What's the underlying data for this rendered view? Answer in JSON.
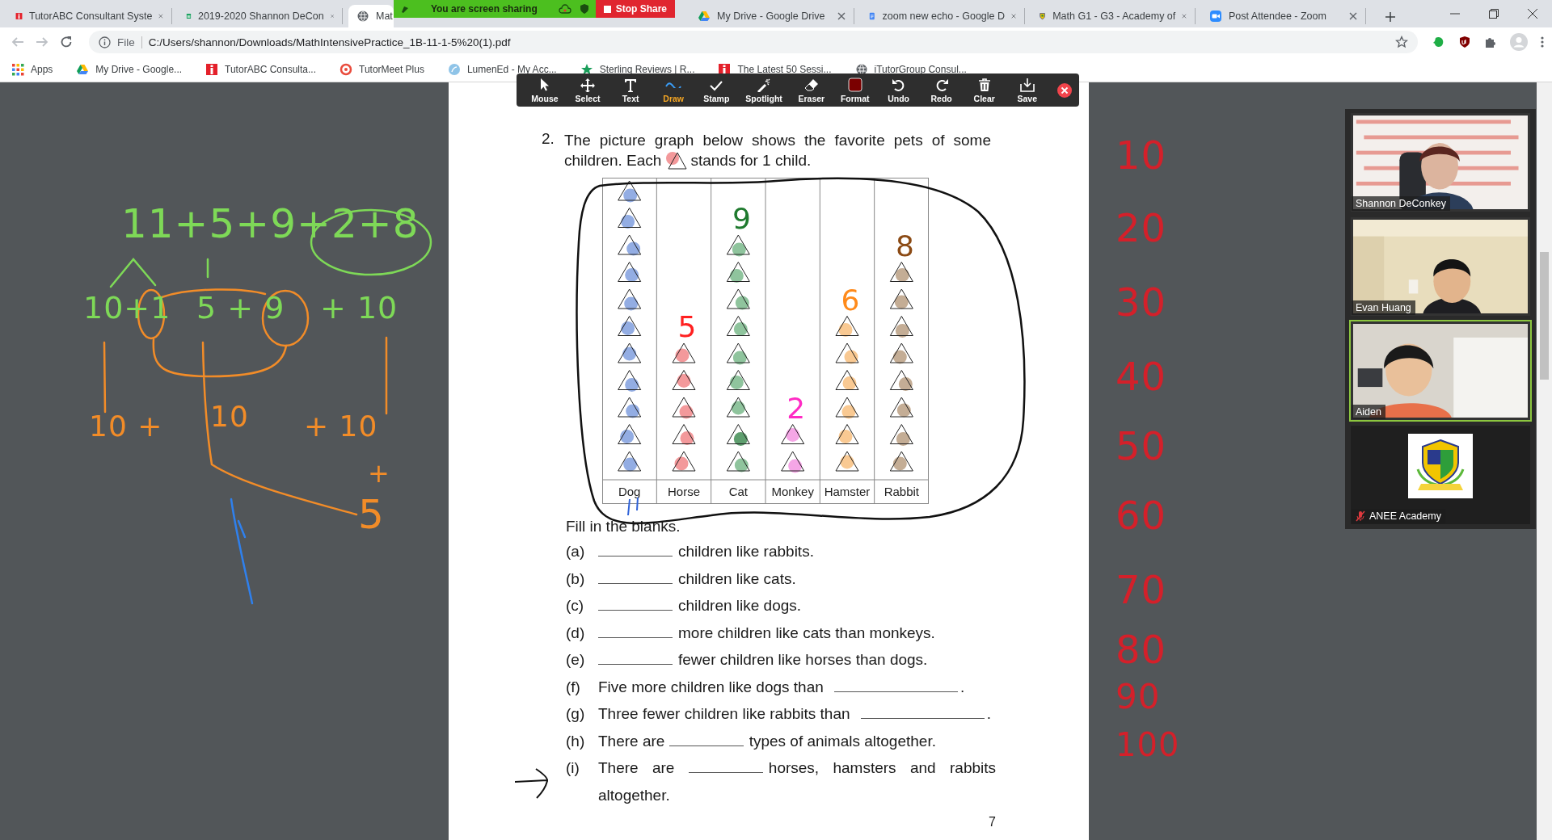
{
  "browser": {
    "tabs": [
      {
        "title": "TutorABC Consultant Syste",
        "kind": "square",
        "selected": false
      },
      {
        "title": "2019-2020 Shannon DeCon",
        "kind": "sheet",
        "selected": false
      },
      {
        "title": "Mat",
        "kind": "globe",
        "selected": true
      },
      {
        "title": "My Drive - Google Drive",
        "kind": "triangle",
        "selected": false
      },
      {
        "title": "zoom new echo - Google D",
        "kind": "doc",
        "selected": false
      },
      {
        "title": "Math G1 - G3 - Academy of",
        "kind": "shield",
        "selected": false
      },
      {
        "title": "Post Attendee - Zoom",
        "kind": "camera",
        "selected": false
      }
    ],
    "address": {
      "scheme": "File",
      "url": "C:/Users/shannon/Downloads/MathIntensivePractice_1B-11-1-5%20(1).pdf"
    },
    "bookmarks": [
      {
        "label": "Apps",
        "kind": "grid"
      },
      {
        "label": "My Drive - Google...",
        "kind": "triangle"
      },
      {
        "label": "TutorABC Consulta...",
        "kind": "square"
      },
      {
        "label": "TutorMeet Plus",
        "kind": "ring"
      },
      {
        "label": "LumenEd - My Acc...",
        "kind": "disc"
      },
      {
        "label": "Sterling Reviews | R...",
        "kind": "star"
      },
      {
        "label": "The Latest 50 Sessi...",
        "kind": "square"
      },
      {
        "label": "iTutorGroup Consul...",
        "kind": "globe"
      }
    ]
  },
  "screen_share_bar": {
    "status": "You are screen sharing",
    "stop_button": "Stop Share"
  },
  "annotation_toolbar": {
    "tools": [
      {
        "label": "Mouse",
        "selected": false
      },
      {
        "label": "Select",
        "selected": false
      },
      {
        "label": "Text",
        "selected": false
      },
      {
        "label": "Draw",
        "selected": true
      },
      {
        "label": "Stamp",
        "selected": false
      },
      {
        "label": "Spotlight",
        "selected": false
      },
      {
        "label": "Eraser",
        "selected": false
      },
      {
        "label": "Format",
        "selected": false
      },
      {
        "label": "Undo",
        "selected": false
      },
      {
        "label": "Redo",
        "selected": false
      },
      {
        "label": "Clear",
        "selected": false
      },
      {
        "label": "Save",
        "selected": false
      }
    ]
  },
  "document": {
    "question": {
      "number": "2.",
      "line": "The picture graph below shows the favorite pets of some",
      "legend_before": "children. Each",
      "legend_after": "stands for 1 child."
    },
    "graph": {
      "columns": [
        {
          "label": "Dog",
          "symbols": [
            {
              "color": "#93ade3"
            },
            {
              "color": "#93ade3"
            },
            {
              "color": "#93ade3"
            },
            {
              "color": "#93ade3"
            },
            {
              "color": "#93ade3"
            },
            {
              "color": "#93ade3"
            },
            {
              "color": "#93ade3"
            },
            {
              "color": "#93ade3"
            },
            {
              "color": "#93ade3"
            },
            {
              "color": "#93ade3"
            },
            {
              "color": "#93ade3"
            }
          ]
        },
        {
          "label": "Horse",
          "symbols": [
            {
              "color": "#f3999b"
            },
            {
              "color": "#f3999b"
            },
            {
              "color": "#f3999b"
            },
            {
              "color": "#f3999b"
            },
            {
              "color": "#f3999b"
            }
          ],
          "note": {
            "text": "5",
            "color": "#ff2020"
          }
        },
        {
          "label": "Cat",
          "symbols": [
            {
              "color": "#8fc49d"
            },
            {
              "color": "#5e9e6e"
            },
            {
              "color": "#8fc49d"
            },
            {
              "color": "#8fc49d"
            },
            {
              "color": "#8fc49d"
            },
            {
              "color": "#8fc49d"
            },
            {
              "color": "#8fc49d"
            },
            {
              "color": "#8fc49d"
            },
            {
              "color": "#8fc49d"
            }
          ],
          "note": {
            "text": "9",
            "color": "#1f7a2e"
          }
        },
        {
          "label": "Monkey",
          "symbols": [
            {
              "color": "#f5a6e6"
            },
            {
              "color": "#f5a6e6"
            }
          ],
          "note": {
            "text": "2",
            "color": "#ff2bc4"
          }
        },
        {
          "label": "Hamster",
          "symbols": [
            {
              "color": "#f9c992"
            },
            {
              "color": "#f9c992"
            },
            {
              "color": "#f9c992"
            },
            {
              "color": "#f9c992"
            },
            {
              "color": "#f9c992"
            },
            {
              "color": "#f9c992"
            }
          ],
          "note": {
            "text": "6",
            "color": "#ff8a1a"
          }
        },
        {
          "label": "Rabbit",
          "symbols": [
            {
              "color": "#c4ad95"
            },
            {
              "color": "#c4ad95"
            },
            {
              "color": "#c4ad95"
            },
            {
              "color": "#c4ad95"
            },
            {
              "color": "#c4ad95"
            },
            {
              "color": "#c4ad95"
            },
            {
              "color": "#c4ad95"
            },
            {
              "color": "#c4ad95"
            }
          ],
          "note": {
            "text": "8",
            "color": "#8b4a14"
          }
        }
      ]
    },
    "instruction": "Fill in the blanks.",
    "items": [
      {
        "label": "(a)",
        "segments": [
          {
            "kind": "blank"
          },
          {
            "kind": "text",
            "text": "children like rabbits."
          }
        ]
      },
      {
        "label": "(b)",
        "segments": [
          {
            "kind": "blank"
          },
          {
            "kind": "text",
            "text": "children like cats."
          }
        ]
      },
      {
        "label": "(c)",
        "segments": [
          {
            "kind": "blank"
          },
          {
            "kind": "text",
            "text": "children like dogs."
          }
        ]
      },
      {
        "label": "(d)",
        "segments": [
          {
            "kind": "blank"
          },
          {
            "kind": "text",
            "text": "more children like cats than monkeys."
          }
        ]
      },
      {
        "label": "(e)",
        "segments": [
          {
            "kind": "blank"
          },
          {
            "kind": "text",
            "text": "fewer children like horses than dogs."
          }
        ]
      },
      {
        "label": "(f)",
        "segments": [
          {
            "kind": "text",
            "text": "Five more children like dogs than"
          },
          {
            "kind": "long_blank"
          },
          {
            "kind": "text",
            "text": "."
          }
        ]
      },
      {
        "label": "(g)",
        "segments": [
          {
            "kind": "text",
            "text": "Three fewer children like rabbits than"
          },
          {
            "kind": "long_blank"
          },
          {
            "kind": "text",
            "text": "."
          }
        ]
      },
      {
        "label": "(h)",
        "segments": [
          {
            "kind": "text",
            "text": "There are"
          },
          {
            "kind": "blank"
          },
          {
            "kind": "text",
            "text": "types of animals altogether."
          }
        ]
      },
      {
        "label": "(i)",
        "segments": [
          {
            "kind": "text",
            "text": "There are"
          },
          {
            "kind": "blank"
          },
          {
            "kind": "text",
            "text": "horses, hamsters and rabbits"
          },
          {
            "kind": "text",
            "text": "altogether."
          }
        ]
      }
    ],
    "page_number": "7"
  },
  "ink_notes": [
    {
      "text": "11+5+9+2+8",
      "color": "#7ed957"
    },
    {
      "text": "10+1",
      "color": "#7ed957"
    },
    {
      "text": "5 + 9",
      "color": "#7ed957"
    },
    {
      "text": "+ 10",
      "color": "#7ed957"
    },
    {
      "text": "10 +",
      "color": "#f28c28"
    },
    {
      "text": "10",
      "color": "#f28c28"
    },
    {
      "text": "+ 10",
      "color": "#f28c28"
    },
    {
      "text": "+",
      "color": "#f28c28"
    },
    {
      "text": "5",
      "color": "#f28c28"
    },
    {
      "text": "10",
      "color": "#d4202a"
    },
    {
      "text": "20",
      "color": "#d4202a"
    },
    {
      "text": "30",
      "color": "#d4202a"
    },
    {
      "text": "40",
      "color": "#d4202a"
    },
    {
      "text": "50",
      "color": "#d4202a"
    },
    {
      "text": "60",
      "color": "#d4202a"
    },
    {
      "text": "70",
      "color": "#d4202a"
    },
    {
      "text": "80",
      "color": "#d4202a"
    },
    {
      "text": "90",
      "color": "#d4202a"
    },
    {
      "text": "100",
      "color": "#d4202a"
    }
  ],
  "video_panel": {
    "tiles": [
      {
        "name": "Shannon DeConkey",
        "kind": "video",
        "active": false,
        "muted": false
      },
      {
        "name": "Evan Huang",
        "kind": "video",
        "active": false,
        "muted": false
      },
      {
        "name": "Aiden",
        "kind": "video",
        "active": true,
        "muted": false
      },
      {
        "name": "ANEE Academy",
        "kind": "logo",
        "active": false,
        "muted": true
      }
    ]
  }
}
